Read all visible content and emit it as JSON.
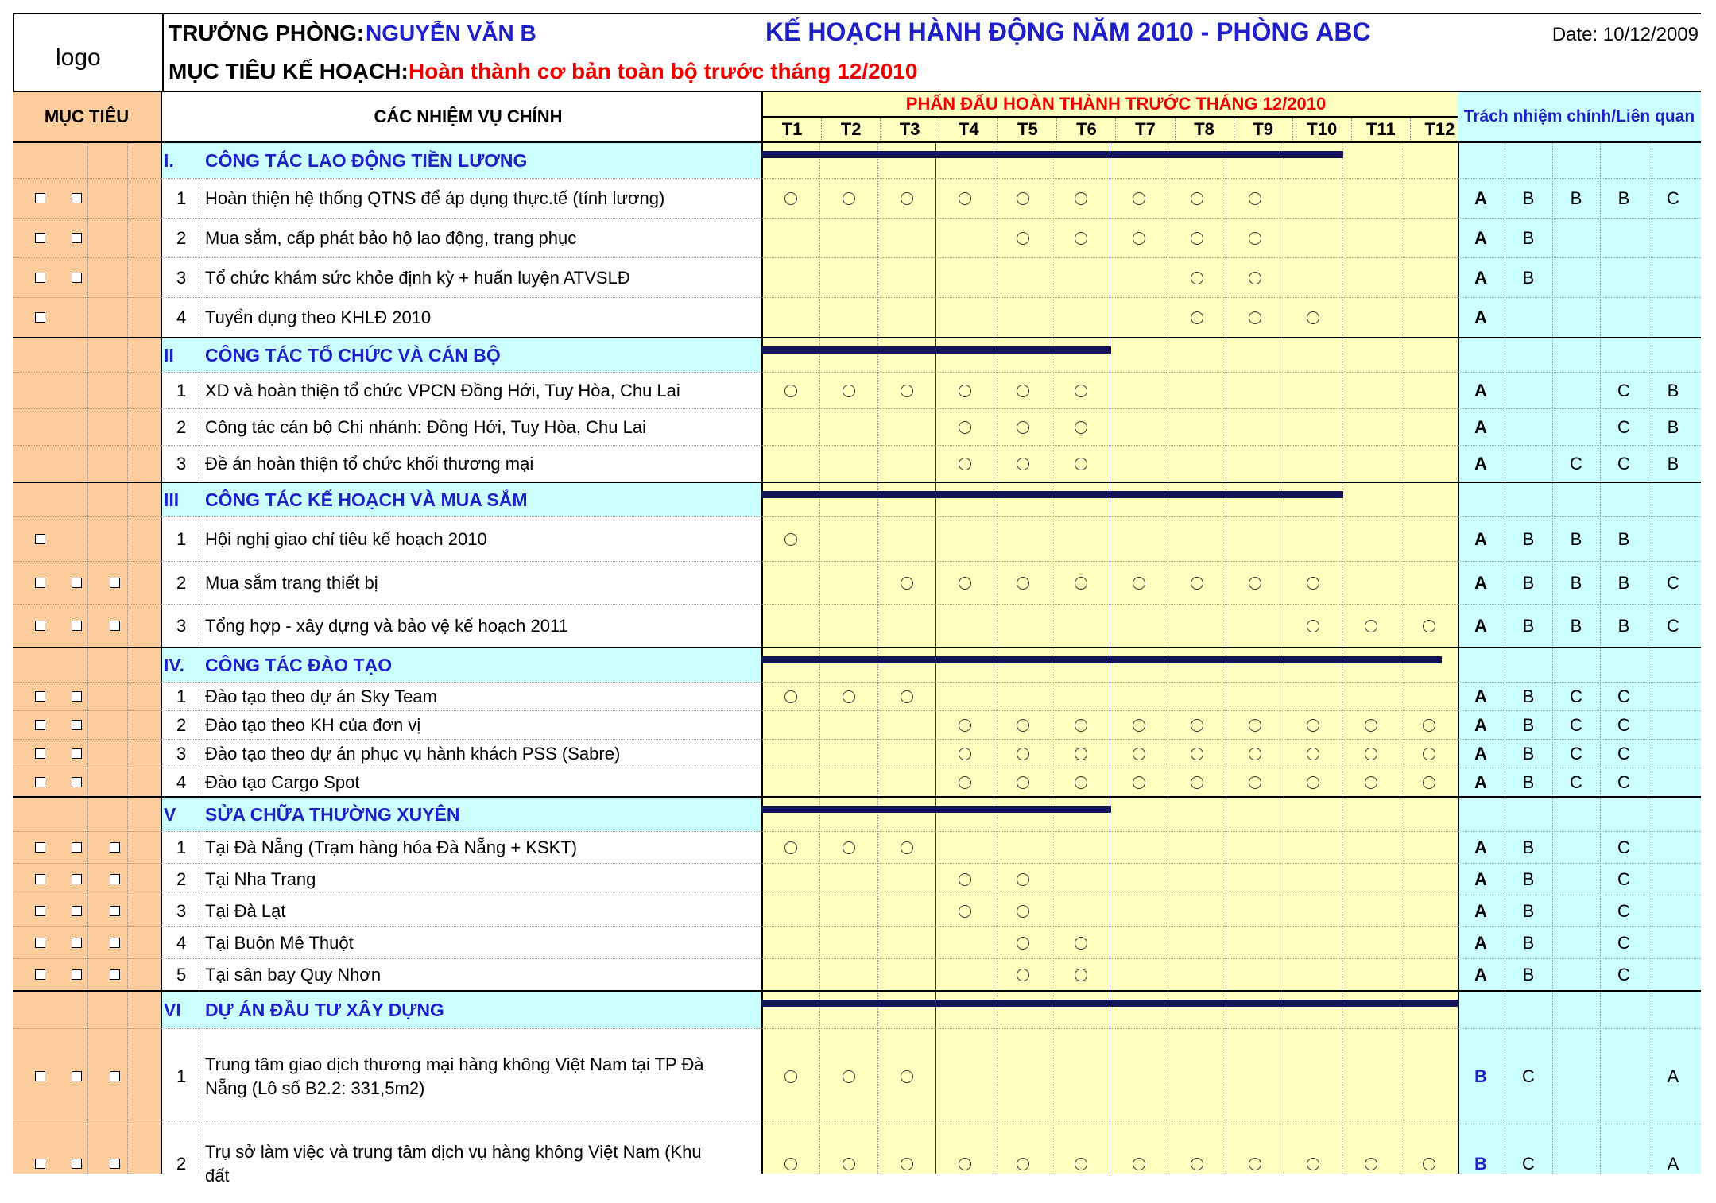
{
  "header": {
    "logo": "logo",
    "head_label": "TRƯỞNG PHÒNG:",
    "head_name": "NGUYỄN VĂN B",
    "objective_label": "MỤC TIÊU KẾ HOẠCH:",
    "objective_text": "Hoàn thành cơ bản toàn bộ trước tháng 12/2010",
    "plan_title": "KẾ HOẠCH HÀNH ĐỘNG NĂM 2010 - PHÒNG ABC",
    "date_label": "Date:",
    "date_value": "10/12/2009"
  },
  "columns": {
    "muc_tieu": "MỤC TIÊU",
    "tasks": "CÁC NHIỆM VỤ CHÍNH",
    "months_title": "PHẤN ĐẤU HOÀN THÀNH TRƯỚC THÁNG 12/2010",
    "months": [
      "T1",
      "T2",
      "T3",
      "T4",
      "T5",
      "T6",
      "T7",
      "T8",
      "T9",
      "T10",
      "T11",
      "T12"
    ],
    "responsibility": "Trách nhiệm chính/Liên quan"
  },
  "sections": [
    {
      "num": "I.",
      "title": "CÔNG TÁC LAO ĐỘNG TIỀN LƯƠNG",
      "bar_months": 10,
      "tasks": [
        {
          "num": "1",
          "text": "Hoàn thiện hệ thống QTNS để áp dụng thực.tế (tính lương)",
          "checkboxes": 2,
          "months": [
            1,
            2,
            3,
            4,
            5,
            6,
            7,
            8,
            9
          ],
          "resp": [
            "A",
            "B",
            "B",
            "B",
            "C"
          ]
        },
        {
          "num": "2",
          "text": "Mua sắm, cấp phát bảo hộ lao động, trang phục",
          "checkboxes": 2,
          "months": [
            5,
            6,
            7,
            8,
            9
          ],
          "resp": [
            "A",
            "B",
            "",
            "",
            ""
          ]
        },
        {
          "num": "3",
          "text": "Tổ chức khám sức khỏe định kỳ + huấn luyện ATVSLĐ",
          "checkboxes": 2,
          "months": [
            8,
            9
          ],
          "resp": [
            "A",
            "B",
            "",
            "",
            ""
          ]
        },
        {
          "num": "4",
          "text": "Tuyển dụng theo KHLĐ 2010",
          "checkboxes": 1,
          "months": [
            8,
            9,
            10
          ],
          "resp": [
            "A",
            "",
            "",
            "",
            ""
          ]
        }
      ]
    },
    {
      "num": "II",
      "title": "CÔNG TÁC TỔ CHỨC VÀ CÁN BỘ",
      "bar_months": 6,
      "tasks": [
        {
          "num": "1",
          "text": "XD và hoàn thiện tổ chức VPCN Đồng Hới, Tuy Hòa, Chu Lai",
          "checkboxes": 0,
          "months": [
            1,
            2,
            3,
            4,
            5,
            6
          ],
          "resp": [
            "A",
            "",
            "",
            "C",
            "B"
          ]
        },
        {
          "num": "2",
          "text": "Công tác cán bộ Chi nhánh: Đồng Hới, Tuy Hòa, Chu Lai",
          "checkboxes": 0,
          "months": [
            4,
            5,
            6
          ],
          "resp": [
            "A",
            "",
            "",
            "C",
            "B"
          ]
        },
        {
          "num": "3",
          "text": "Đề án hoàn thiện tổ chức khối thương mại",
          "checkboxes": 0,
          "months": [
            4,
            5,
            6
          ],
          "resp": [
            "A",
            "",
            "C",
            "C",
            "B"
          ]
        }
      ]
    },
    {
      "num": "III",
      "title": "CÔNG TÁC KẾ HOẠCH VÀ MUA SẮM",
      "bar_months": 10,
      "tasks": [
        {
          "num": "1",
          "text": "Hội nghị giao chỉ tiêu kế hoạch 2010",
          "checkboxes": 1,
          "months": [
            1
          ],
          "resp": [
            "A",
            "B",
            "B",
            "B",
            ""
          ]
        },
        {
          "num": "2",
          "text": "Mua sắm trang thiết bị",
          "checkboxes": 3,
          "months": [
            3,
            4,
            5,
            6,
            7,
            8,
            9,
            10
          ],
          "resp": [
            "A",
            "B",
            "B",
            "B",
            "C"
          ]
        },
        {
          "num": "3",
          "text": "Tổng hợp - xây dựng và bảo vệ kế hoạch 2011",
          "checkboxes": 3,
          "months": [
            10,
            11,
            12
          ],
          "resp": [
            "A",
            "B",
            "B",
            "B",
            "C"
          ]
        }
      ]
    },
    {
      "num": "IV.",
      "title": "CÔNG TÁC ĐÀO TẠO",
      "bar_months": 11.7,
      "tasks": [
        {
          "num": "1",
          "text": "Đào tạo theo dự án Sky Team",
          "checkboxes": 2,
          "months": [
            1,
            2,
            3
          ],
          "resp": [
            "A",
            "B",
            "C",
            "C",
            ""
          ]
        },
        {
          "num": "2",
          "text": "Đào tạo theo KH của đơn vị",
          "checkboxes": 2,
          "months": [
            4,
            5,
            6,
            7,
            8,
            9,
            10,
            11,
            12
          ],
          "resp": [
            "A",
            "B",
            "C",
            "C",
            ""
          ]
        },
        {
          "num": "3",
          "text": "Đào tạo theo dự án phục vụ hành khách PSS (Sabre)",
          "checkboxes": 2,
          "months": [
            4,
            5,
            6,
            7,
            8,
            9,
            10,
            11,
            12
          ],
          "resp": [
            "A",
            "B",
            "C",
            "C",
            ""
          ]
        },
        {
          "num": "4",
          "text": "Đào tạo Cargo Spot",
          "checkboxes": 2,
          "months": [
            4,
            5,
            6,
            7,
            8,
            9,
            10,
            11,
            12
          ],
          "resp": [
            "A",
            "B",
            "C",
            "C",
            ""
          ]
        }
      ]
    },
    {
      "num": "V",
      "title": "SỬA CHỮA THƯỜNG XUYÊN",
      "bar_months": 6,
      "tasks": [
        {
          "num": "1",
          "text": "Tại Đà Nẵng (Trạm hàng hóa Đà Nẵng + KSKT)",
          "checkboxes": 3,
          "months": [
            1,
            2,
            3
          ],
          "resp": [
            "A",
            "B",
            "",
            "C",
            ""
          ]
        },
        {
          "num": "2",
          "text": "Tại Nha Trang",
          "checkboxes": 3,
          "months": [
            4,
            5
          ],
          "resp": [
            "A",
            "B",
            "",
            "C",
            ""
          ]
        },
        {
          "num": "3",
          "text": "Tại Đà Lạt",
          "checkboxes": 3,
          "months": [
            4,
            5
          ],
          "resp": [
            "A",
            "B",
            "",
            "C",
            ""
          ]
        },
        {
          "num": "4",
          "text": "Tại Buôn Mê Thuột",
          "checkboxes": 3,
          "months": [
            5,
            6
          ],
          "resp": [
            "A",
            "B",
            "",
            "C",
            ""
          ]
        },
        {
          "num": "5",
          "text": "Tại sân bay Quy Nhơn",
          "checkboxes": 3,
          "months": [
            5,
            6
          ],
          "resp": [
            "A",
            "B",
            "",
            "C",
            ""
          ]
        }
      ]
    },
    {
      "num": "VI",
      "title": "DỰ ÁN ĐẦU TƯ XÂY DỰNG",
      "bar_months": 12,
      "tasks": [
        {
          "num": "1",
          "text": "Trung tâm giao dịch thương mại hàng không Việt Nam  tại TP Đà Nẵng (Lô số B2.2: 331,5m2)",
          "checkboxes": 3,
          "months": [
            1,
            2,
            3
          ],
          "resp": [
            "B",
            "C",
            "",
            "",
            "A"
          ],
          "first_blue": true
        },
        {
          "num": "2",
          "text": "Trụ sở làm việc và trung tâm dịch vụ hàng không Việt Nam (Khu đất",
          "checkboxes": 3,
          "months": [
            1,
            2,
            3,
            4,
            5,
            6,
            7,
            8,
            9,
            10,
            11,
            12
          ],
          "resp": [
            "B",
            "C",
            "",
            "",
            "A"
          ],
          "first_blue": true
        }
      ]
    }
  ]
}
